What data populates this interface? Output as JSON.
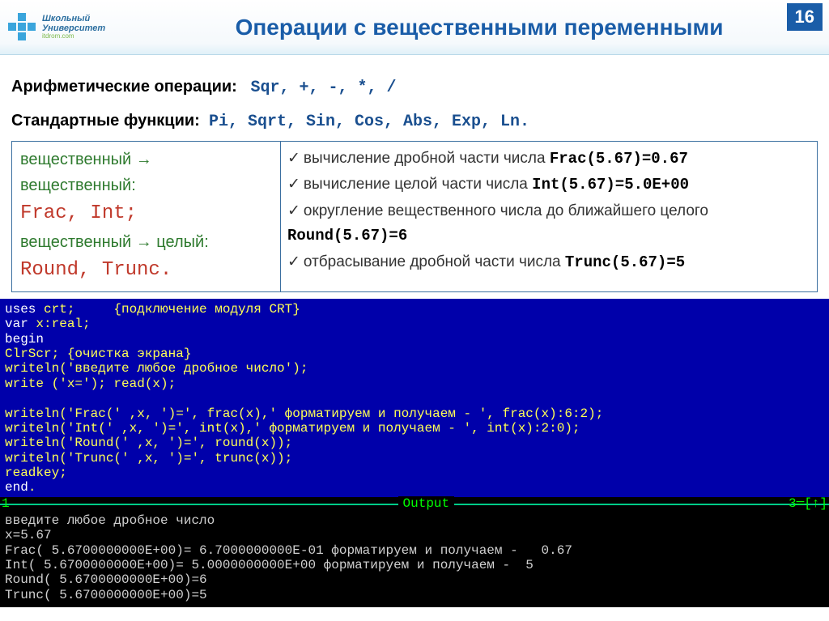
{
  "header": {
    "logo_line1": "Школьный",
    "logo_line2": "Университет",
    "logo_line3": "itdrom.com",
    "title": "Операции с вещественными переменными",
    "slide_number": "16"
  },
  "section1": {
    "arith_label": "Арифметические операции:",
    "arith_ops": "Sqr, +, -, *, /",
    "std_label": "Стандартные функции:",
    "std_fns": "Pi, Sqrt, Sin, Cos, Abs, Exp, Ln."
  },
  "left_col": {
    "conv1": "вещественный → вещественный:",
    "fns1": "Frac, Int;",
    "conv2": "вещественный → целый:",
    "fns2": "Round, Trunc."
  },
  "right_col": {
    "b1_text": "вычисление дробной части числа ",
    "b1_code": "Frac(5.67)=0.67",
    "b2_text": "вычисление целой части числа ",
    "b2_code": "Int(5.67)=5.0E+00",
    "b3_text": "округление вещественного числа до ближайшего целого ",
    "b3_code": "Round(5.67)=6",
    "b4_text": "отбрасывание дробной части числа ",
    "b4_code": "Trunc(5.67)=5"
  },
  "code": {
    "l1a": "uses",
    "l1b": " crt;     {подключение модуля CRT}",
    "l2a": "var",
    "l2b": " x:real;",
    "l3a": "begin",
    "l4": "ClrScr; {очистка экрана}",
    "l5": "writeln('введите любое дробное число');",
    "l6": "write ('x='); read(x);",
    "l7": "",
    "l8": "writeln('Frac(' ,x, ')=', frac(x),' форматируем и получаем - ', frac(x):6:2);",
    "l9": "writeln('Int(' ,x, ')=', int(x),' форматируем и получаем - ', int(x):2:0);",
    "l10": "writeln('Round(' ,x, ')=', round(x));",
    "l11": "writeln('Trunc(' ,x, ')=', trunc(x));",
    "l12": "readkey;",
    "l13a": "end",
    "l13b": "."
  },
  "output_bar": {
    "left": "1",
    "mid": "Output",
    "right": "3═[↑]"
  },
  "output": {
    "o1": "введите любое дробное число",
    "o2": "x=5.67",
    "o3": "Frac( 5.6700000000E+00)= 6.7000000000E-01 форматируем и получаем -   0.67",
    "o4": "Int( 5.6700000000E+00)= 5.0000000000E+00 форматируем и получаем -  5",
    "o5": "Round( 5.6700000000E+00)=6",
    "o6": "Trunc( 5.6700000000E+00)=5"
  }
}
